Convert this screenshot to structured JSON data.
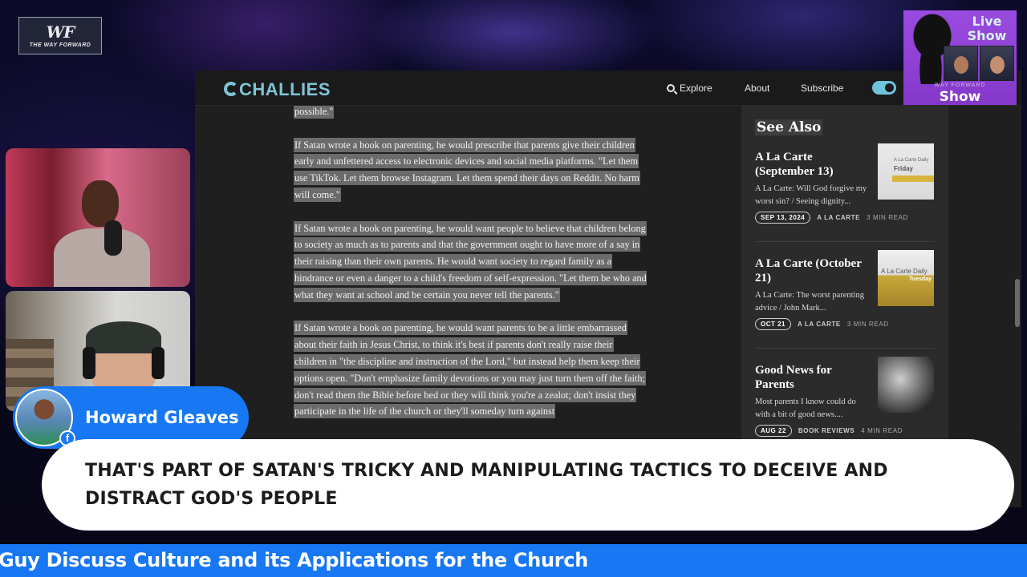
{
  "logo": {
    "mark": "WF",
    "text": "THE WAY FORWARD"
  },
  "site": {
    "brand": "CHALLIES",
    "nav": {
      "explore": "Explore",
      "about": "About",
      "subscribe": "Subscribe"
    }
  },
  "article": {
    "paragraphs": [
      "possible.\"",
      "If Satan wrote a book on parenting, he would prescribe that parents give their children early and unfettered access to electronic devices and social media platforms. \"Let them use TikTok. Let them browse Instagram. Let them spend their days on Reddit. No harm will come.\"",
      "If Satan wrote a book on parenting, he would want people to believe that children belong to society as much as to parents and that the government ought to have more of a say in their raising than their own parents. He would want society to regard family as a hindrance or even a danger to a child's freedom of self-expression. \"Let them be who and what they want at school and be certain you never tell the parents.\"",
      "If Satan wrote a book on parenting, he would want parents to be a little embarrassed about their faith in Jesus Christ, to think it's best if parents don't really raise their children in \"the discipline and instruction of the Lord,\" but instead help them keep their options open. \"Don't emphasize family devotions or you may just turn them off the faith; don't read them the Bible before bed or they will think you're a zealot; don't insist they participate in the life of the church or they'll someday turn against"
    ]
  },
  "sidebar": {
    "heading": "See Also",
    "cards": [
      {
        "title": "A La Carte (September 13)",
        "excerpt": "A La Carte: Will God forgive my worst sin? / Seeing dignity...",
        "date": "SEP 13, 2024",
        "category": "A LA CARTE",
        "read": "3 MIN READ",
        "thumb_small": "A La Carte Daily",
        "thumb_day": "Friday"
      },
      {
        "title": "A La Carte (October 21)",
        "excerpt": "A La Carte: The worst parenting advice / John Mark...",
        "date": "OCT 21",
        "category": "A LA CARTE",
        "read": "3 MIN READ",
        "thumb_small": "A La Carte Daily",
        "thumb_day": "Tuesday"
      },
      {
        "title": "Good News for Parents",
        "excerpt": "Most parents I know could do with a bit of good news....",
        "date": "AUG 22",
        "category": "BOOK REVIEWS",
        "read": "4 MIN READ"
      }
    ]
  },
  "live_show": {
    "top": "Live Show",
    "small": "WAY FORWARD",
    "bottom": "Show"
  },
  "nametag": {
    "name": "Howard Gleaves",
    "fb": "f"
  },
  "comment": {
    "text": "THAT'S PART OF SATAN'S TRICKY AND MANIPULATING TACTICS TO DECEIVE AND DISTRACT GOD'S PEOPLE"
  },
  "ticker": {
    "text": "Guy Discuss Culture and its Applications for the Church"
  },
  "colors": {
    "brand_blue": "#1877f2",
    "challies_teal": "#7fc4d6",
    "live_purple": "#8f42d6"
  }
}
